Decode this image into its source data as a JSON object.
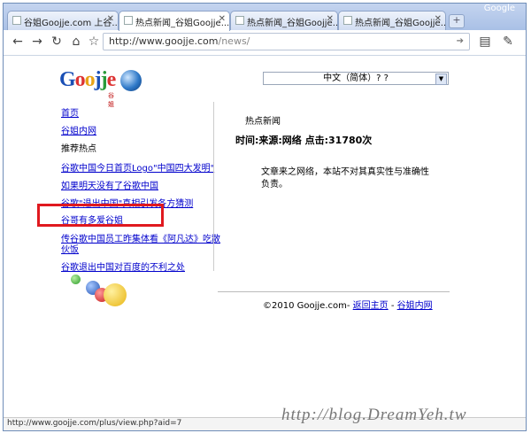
{
  "browser": {
    "brand": "Google",
    "tabs": [
      {
        "label": "谷姐Goojje.com 上谷..."
      },
      {
        "label": "热点新闻_谷姐Goojje....",
        "active": true
      },
      {
        "label": "热点新闻_谷姐Goojje...."
      },
      {
        "label": "热点新闻_谷姐Goojje...."
      }
    ],
    "url_host": "http://www.goojje.com",
    "url_path": "/news/",
    "status_url": "http://www.goojje.com/plus/view.php?aid=7"
  },
  "page": {
    "logo_text": "Goojje",
    "logo_tag": "谷姐",
    "language_selected": "中文（简体）? ?",
    "sidebar": [
      {
        "label": "首页",
        "link": true
      },
      {
        "label": "谷姐内网",
        "link": true
      },
      {
        "label": "推荐热点",
        "link": false
      },
      {
        "label": "谷歌中国今日首页Logo\"中国四大发明\"",
        "link": true
      },
      {
        "label": "如果明天没有了谷歌中国",
        "link": true
      },
      {
        "label": "谷歌\"退出中国\"真相引发各方猜测",
        "link": true
      },
      {
        "label": "谷哥有多爱谷姐",
        "link": true,
        "highlighted": true
      },
      {
        "label": "传谷歌中国员工昨集体看《阿凡达》吃散",
        "link": true
      },
      {
        "label": "伙饭",
        "link": true
      },
      {
        "label": "谷歌退出中国对百度的不利之处",
        "link": true
      }
    ],
    "main": {
      "title": "热点新闻",
      "meta": "时间:来源:网络 点击:31780次",
      "body": "文章来之网络，本站不对其真实性与准确性负责。"
    },
    "footer": {
      "copyright": "©2010 Goojje.com-",
      "link1": "返回主页",
      "separator": "-",
      "link2": "谷姐内网"
    }
  },
  "watermark": "http://blog.DreamYeh.tw",
  "colors": {
    "highlight": "#e0191f",
    "link": "#0000cc"
  }
}
